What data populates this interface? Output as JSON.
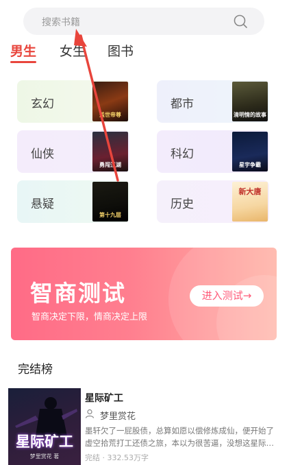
{
  "search": {
    "placeholder": "搜索书籍",
    "icon": "search-icon"
  },
  "tabs": [
    {
      "label": "男生",
      "active": true
    },
    {
      "label": "女生",
      "active": false
    },
    {
      "label": "图书",
      "active": false
    }
  ],
  "genres": [
    {
      "label": "玄幻",
      "cover_text": "盖世帝尊"
    },
    {
      "label": "都市",
      "cover_text": "清明情的故事"
    },
    {
      "label": "仙侠",
      "cover_text": "勇闯江湖"
    },
    {
      "label": "科幻",
      "cover_text": "星宇争霸"
    },
    {
      "label": "悬疑",
      "cover_text": "第十九层"
    },
    {
      "label": "历史",
      "cover_text": "新大唐"
    }
  ],
  "banner": {
    "title": "智商测试",
    "subtitle": "智商决定下限，情商决定上限",
    "button": "进入测试→"
  },
  "section": {
    "title": "完结榜"
  },
  "book": {
    "title": "星际矿工",
    "author": "梦里赏花",
    "description": "墨轩欠了一屁股债，总算如愿以偿修炼成仙，便开始了虚空拾荒打工还债之旅，本以为很苦逼，没想这星际…",
    "meta": "完结 · 332.53万字",
    "cover_title": "星际矿工",
    "cover_author": "梦里赏花 著"
  },
  "colors": {
    "accent": "#e8453c",
    "banner_start": "#ff6b86",
    "banner_end": "#ffb3a6",
    "annotation_arrow": "#e8453c"
  }
}
